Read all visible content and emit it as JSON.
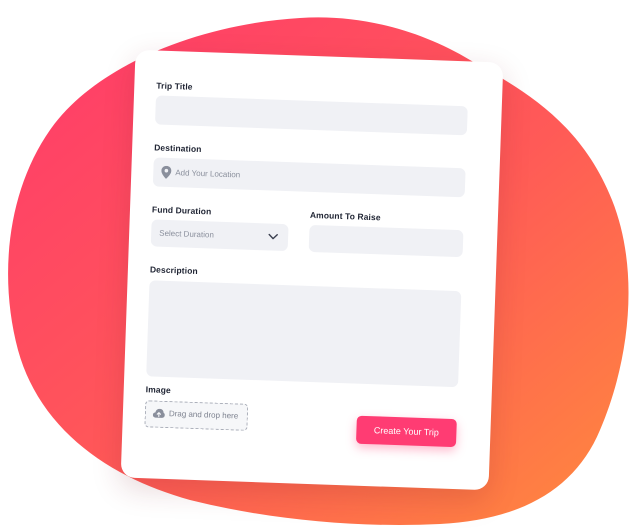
{
  "form": {
    "trip_title": {
      "label": "Trip Title",
      "value": ""
    },
    "destination": {
      "label": "Destination",
      "placeholder": "Add Your Location"
    },
    "fund_duration": {
      "label": "Fund Duration",
      "selected": "Select Duration"
    },
    "amount": {
      "label": "Amount To Raise",
      "value": ""
    },
    "description": {
      "label": "Description",
      "value": ""
    },
    "image": {
      "label": "Image",
      "dropzone_text": "Drag and drop here"
    },
    "submit_label": "Create Your Trip"
  },
  "icons": {
    "location": "location-pin-icon",
    "dropdown": "chevron-down-icon",
    "upload": "cloud-upload-icon"
  },
  "colors": {
    "accent": "#ff3c73",
    "blob_start": "#ff3a6b",
    "blob_end": "#ff8a3d",
    "input_bg": "#f0f1f5"
  }
}
